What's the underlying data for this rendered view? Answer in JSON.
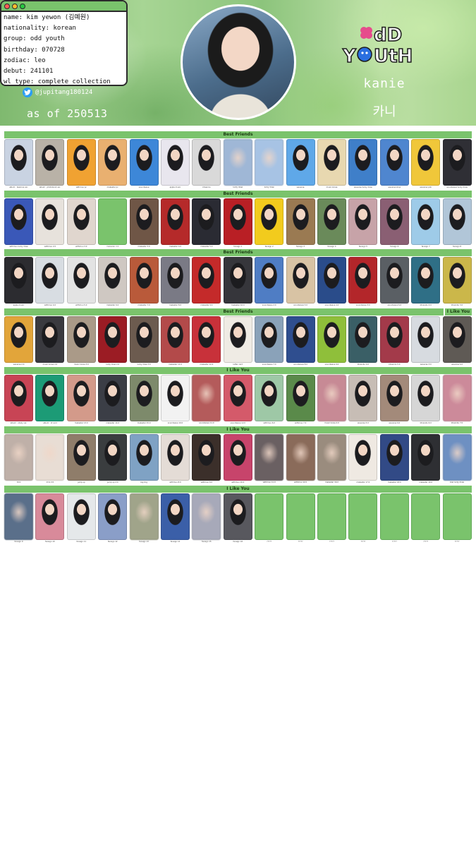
{
  "profile": {
    "lines": [
      "name: kim yewon (김예원)",
      "nationality: korean",
      "group: odd youth",
      "birthday: 070728",
      "zodiac: leo",
      "debut: 241101",
      "wl type: complete collection"
    ],
    "twitter_handle": "@jupitang180124",
    "as_of": "as of 250513",
    "member_name": "kanie",
    "member_name_kr": "카니",
    "logo_text_top": "dD",
    "logo_text_bottom": "YOUtH"
  },
  "colors": {
    "accent_green": "#7ac36c",
    "twitter_blue": "#2a9df4"
  },
  "sections": [
    {
      "label": "Best Friends"
    },
    {
      "label": "Best Friends"
    },
    {
      "label": "Best Friends"
    },
    {
      "label": "Best Friends",
      "right_label": "I Like You"
    },
    {
      "label": "I Like You"
    },
    {
      "label": "I Like You"
    },
    {
      "label": "I Like You"
    }
  ],
  "rows": [
    [
      {
        "caption": "album · teazone ver.",
        "tone": "#c9d3e2"
      },
      {
        "caption": "album · photobook ver.",
        "tone": "#b9b2a7"
      },
      {
        "caption": "withmuu pc",
        "tone": "#f0a232"
      },
      {
        "caption": "makestar pc",
        "tone": "#e9b070"
      },
      {
        "caption": "soundwave",
        "tone": "#3d87d8"
      },
      {
        "caption": "apple music",
        "tone": "#e8e6ee"
      },
      {
        "caption": "ktown4u",
        "tone": "#d9d9d9"
      },
      {
        "caption": "lucky draw",
        "tone": "#9fb7d6",
        "blur": true
      },
      {
        "caption": "lucky draw",
        "tone": "#a7c3e4",
        "blur": true
      },
      {
        "caption": "weverse",
        "tone": "#5fa8e8"
      },
      {
        "caption": "music korea",
        "tone": "#e8d8b0"
      },
      {
        "caption": "weverse lucky draw",
        "tone": "#3f7fc9"
      },
      {
        "caption": "weverse shop",
        "tone": "#4f86cf"
      },
      {
        "caption": "weverse pob",
        "tone": "#f0c73a"
      },
      {
        "caption": "soundwave lucky draw",
        "tone": "#2f2f35"
      }
    ],
    [
      {
        "caption": "withmuu lucky draw",
        "tone": "#3a58b8"
      },
      {
        "caption": "withmuu 2.0",
        "tone": "#e7e2dc"
      },
      {
        "caption": "withmuu 3.0",
        "tone": "#e0d6ce"
      },
      {
        "caption": "makestar 2.0",
        "tone": "#7ac36c",
        "empty_look": true
      },
      {
        "caption": "makestar 3.0",
        "tone": "#6f5646"
      },
      {
        "caption": "makestar 4.0",
        "tone": "#b52a2a"
      },
      {
        "caption": "makestar 5.0",
        "tone": "#2a2b33"
      },
      {
        "caption": "fansign 1",
        "tone": "#b91f25"
      },
      {
        "caption": "fansign 2",
        "tone": "#f2cb1d"
      },
      {
        "caption": "fansign 3",
        "tone": "#9a7a52"
      },
      {
        "caption": "fansign 4",
        "tone": "#6a8a5a"
      },
      {
        "caption": "fansign 5",
        "tone": "#c7a3a8"
      },
      {
        "caption": "fansign 6",
        "tone": "#8a5f73"
      },
      {
        "caption": "fansign 7",
        "tone": "#9ecbe8"
      },
      {
        "caption": "fansign 8",
        "tone": "#b1c6d8"
      }
    ],
    [
      {
        "caption": "apple music",
        "tone": "#2c2c30"
      },
      {
        "caption": "withmuu 4.0",
        "tone": "#d8dde2"
      },
      {
        "caption": "withmuu 5.0",
        "tone": "#e3e3e3"
      },
      {
        "caption": "makestar 6.0",
        "tone": "#cfc8c2"
      },
      {
        "caption": "makestar 7.0",
        "tone": "#b95a3a"
      },
      {
        "caption": "makestar 8.0",
        "tone": "#7a7a85"
      },
      {
        "caption": "makestar 9.0",
        "tone": "#c42a2a"
      },
      {
        "caption": "makestar 10.0",
        "tone": "#36363b"
      },
      {
        "caption": "soundwave 2.0",
        "tone": "#4f7dc4"
      },
      {
        "caption": "soundwave 3.0",
        "tone": "#d8c3a4"
      },
      {
        "caption": "soundwave 4.0",
        "tone": "#2a4c8a"
      },
      {
        "caption": "soundwave 5.0",
        "tone": "#b3262a"
      },
      {
        "caption": "soundwave 6.0",
        "tone": "#5a5f64"
      },
      {
        "caption": "ktown4u 2.0",
        "tone": "#2f6f86"
      },
      {
        "caption": "ktown4u 3.0",
        "tone": "#cbb74a"
      }
    ],
    [
      {
        "caption": "weverse 2.0",
        "tone": "#e2a53a"
      },
      {
        "caption": "music korea 2.0",
        "tone": "#3a3a3f"
      },
      {
        "caption": "music korea 3.0",
        "tone": "#aa9a88"
      },
      {
        "caption": "lucky draw 2.0",
        "tone": "#9b1c24"
      },
      {
        "caption": "lucky draw 3.0",
        "tone": "#6c5b4f"
      },
      {
        "caption": "makestar 11.0",
        "tone": "#b34a4a"
      },
      {
        "caption": "makestar 12.0",
        "tone": "#c8313a"
      },
      {
        "caption": "letter card",
        "tone": "#efebe4"
      },
      {
        "caption": "soundwave 7.0",
        "tone": "#8aa2b9"
      },
      {
        "caption": "soundwave 8.0",
        "tone": "#2f4e8f"
      },
      {
        "caption": "soundwave 9.0",
        "tone": "#8fbf3a"
      },
      {
        "caption": "ktown4u 4.0",
        "tone": "#3a5f66"
      },
      {
        "caption": "ktown4u 5.0",
        "tone": "#a33a4a"
      },
      {
        "caption": "weverse 3.0",
        "tone": "#d7dbe0"
      },
      {
        "caption": "weverse 4.0",
        "tone": "#5f5a55"
      }
    ],
    [
      {
        "caption": "album · study ver.",
        "tone": "#c84455"
      },
      {
        "caption": "album · id card",
        "tone": "#1c9b76"
      },
      {
        "caption": "makestar 13.0",
        "tone": "#d39a8a"
      },
      {
        "caption": "makestar 14.0",
        "tone": "#3b3e46"
      },
      {
        "caption": "makestar 15.0",
        "tone": "#7d8a6b"
      },
      {
        "caption": "soundwave 10.0",
        "tone": "#f2f2f2"
      },
      {
        "caption": "soundwave 11.0",
        "tone": "#b45b5b",
        "blur": true
      },
      {
        "caption": "soundwave 12.0",
        "tone": "#d45a6a"
      },
      {
        "caption": "withmuu 6.0",
        "tone": "#9ec8a6"
      },
      {
        "caption": "withmuu 7.0",
        "tone": "#5a8a4a"
      },
      {
        "caption": "music korea 4.0",
        "tone": "#c78a95",
        "blur": true
      },
      {
        "caption": "weverse 5.0",
        "tone": "#c7bdb5"
      },
      {
        "caption": "weverse 6.0",
        "tone": "#a38a7a"
      },
      {
        "caption": "ktown4u 6.0",
        "tone": "#d6d6d6"
      },
      {
        "caption": "ktown4u 7.0",
        "tone": "#cc8a9a",
        "blur": true
      }
    ],
    [
      {
        "caption": "mini",
        "tone": "#bfb0a8",
        "blur": true
      },
      {
        "caption": "mini 2.0",
        "tone": "#e8ddd4",
        "blur": true
      },
      {
        "caption": "jump up",
        "tone": "#8f7d6a"
      },
      {
        "caption": "jump up 2.0",
        "tone": "#3a3d3f"
      },
      {
        "caption": "keyring",
        "tone": "#7fa2c4"
      },
      {
        "caption": "withmuu 8.0",
        "tone": "#e4dcd6"
      },
      {
        "caption": "withmuu 9.0",
        "tone": "#3b2f2a"
      },
      {
        "caption": "withmuu 10.0",
        "tone": "#c7446b"
      },
      {
        "caption": "withmuu 11.0",
        "tone": "#6a6062",
        "blur": true
      },
      {
        "caption": "withmuu 12.0",
        "tone": "#8a6b5a",
        "blur": true
      },
      {
        "caption": "makestar 16.0",
        "tone": "#9a8c7e",
        "blur": true
      },
      {
        "caption": "makestar 17.0",
        "tone": "#efe9e2"
      },
      {
        "caption": "makestar 18.0",
        "tone": "#324a86"
      },
      {
        "caption": "makestar 19.0",
        "tone": "#2e2f33"
      },
      {
        "caption": "kiwi lucky draw",
        "tone": "#6e90c2",
        "blur": true
      }
    ],
    [
      {
        "caption": "fansign 9",
        "tone": "#5a6f8a",
        "blur": true
      },
      {
        "caption": "fansign 10",
        "tone": "#d88a9a"
      },
      {
        "caption": "fansign 11",
        "tone": "#e5e8ea"
      },
      {
        "caption": "fansign 12",
        "tone": "#8a9ec8"
      },
      {
        "caption": "fansign 13",
        "tone": "#a0a48a",
        "blur": true
      },
      {
        "caption": "fansign 14",
        "tone": "#3b5fa8"
      },
      {
        "caption": "fansign 15",
        "tone": "#a7a9b9",
        "blur": true
      },
      {
        "caption": "fansign 16",
        "tone": "#58585e"
      },
      {
        "caption": "?????",
        "empty": true
      },
      {
        "caption": "?????",
        "empty": true
      },
      {
        "caption": "?????",
        "empty": true
      },
      {
        "caption": "?????",
        "empty": true
      },
      {
        "caption": "?????",
        "empty": true
      },
      {
        "caption": "?????",
        "empty": true
      },
      {
        "caption": "?????",
        "empty": true
      }
    ]
  ]
}
